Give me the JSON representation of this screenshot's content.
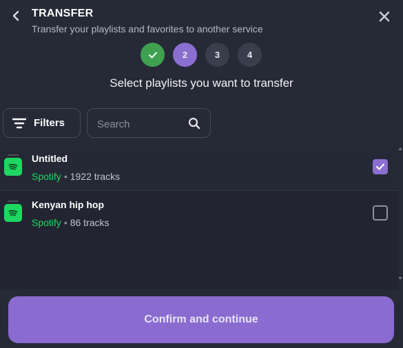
{
  "header": {
    "title": "TRANSFER",
    "subtitle": "Transfer your playlists and favorites to another service"
  },
  "steps": [
    {
      "label": "",
      "state": "done"
    },
    {
      "label": "2",
      "state": "current"
    },
    {
      "label": "3",
      "state": "pending"
    },
    {
      "label": "4",
      "state": "pending"
    }
  ],
  "heading": "Select playlists you want to transfer",
  "toolbar": {
    "filters_label": "Filters",
    "search_placeholder": "Search"
  },
  "playlists": [
    {
      "name": "Untitled",
      "service": "Spotify",
      "separator": "•",
      "tracks": "1922 tracks",
      "selected": true
    },
    {
      "name": "Kenyan hip hop",
      "service": "Spotify",
      "separator": "•",
      "tracks": "86 tracks",
      "selected": false
    }
  ],
  "confirm_label": "Confirm and continue",
  "colors": {
    "background": "#262a37",
    "accent": "#8a6bd0",
    "done": "#3fa14f",
    "spotify": "#1ed760"
  },
  "icons": {
    "back": "chevron-left-icon",
    "close": "close-icon",
    "filters": "filter-lines-icon",
    "search": "search-icon",
    "service": "spotify-icon",
    "check": "check-icon"
  }
}
